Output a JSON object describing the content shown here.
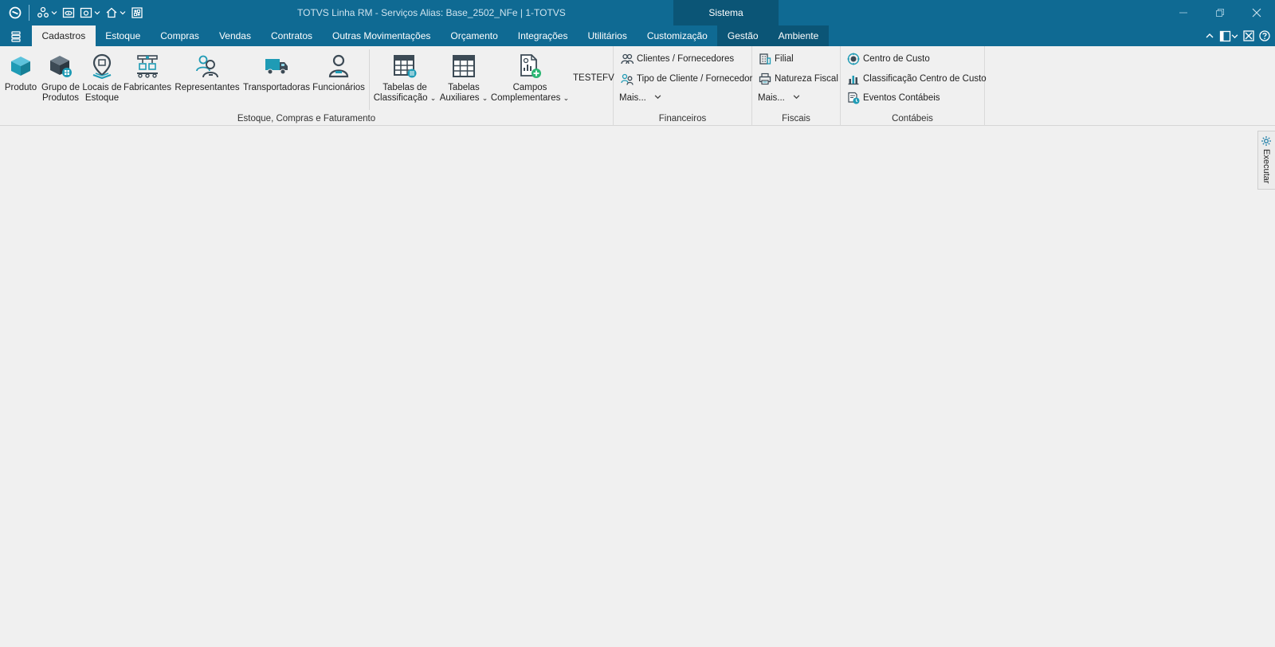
{
  "window": {
    "title": "TOTVS Linha RM - Serviços  Alias: Base_2502_NFe | 1-TOTVS",
    "context_tab_group": "Sistema"
  },
  "tabs": [
    {
      "label": "Cadastros",
      "active": true
    },
    {
      "label": "Estoque"
    },
    {
      "label": "Compras"
    },
    {
      "label": "Vendas"
    },
    {
      "label": "Contratos"
    },
    {
      "label": "Outras Movimentações"
    },
    {
      "label": "Orçamento"
    },
    {
      "label": "Integrações"
    },
    {
      "label": "Utilitários"
    },
    {
      "label": "Customização"
    },
    {
      "label": "Gestão",
      "context": true
    },
    {
      "label": "Ambiente",
      "context": true
    }
  ],
  "ribbon": {
    "estoque": {
      "label": "Estoque, Compras e Faturamento",
      "buttons": [
        {
          "line1": "Produto",
          "line2": ""
        },
        {
          "line1": "Grupo de",
          "line2": "Produtos"
        },
        {
          "line1": "Locais de",
          "line2": "Estoque"
        },
        {
          "line1": "Fabricantes",
          "line2": ""
        },
        {
          "line1": "Representantes",
          "line2": ""
        },
        {
          "line1": "Transportadoras",
          "line2": ""
        },
        {
          "line1": "Funcionários",
          "line2": ""
        },
        {
          "line1": "Tabelas de",
          "line2": "Classificação"
        },
        {
          "line1": "Tabelas",
          "line2": "Auxiliares"
        },
        {
          "line1": "Campos",
          "line2": "Complementares"
        }
      ],
      "testefv": "TESTEFV"
    },
    "financeiros": {
      "label": "Financeiros",
      "items": [
        "Clientes / Fornecedores",
        "Tipo de Cliente / Fornecedor",
        "Mais..."
      ]
    },
    "fiscais": {
      "label": "Fiscais",
      "items": [
        "Filial",
        "Natureza Fiscal",
        "Mais..."
      ]
    },
    "contabeis": {
      "label": "Contábeis",
      "items": [
        "Centro de Custo",
        "Classificação Centro de Custo",
        "Eventos Contábeis"
      ]
    }
  },
  "side_panel": {
    "label": "Executar"
  },
  "colors": {
    "titlebar": "#0f6a93",
    "context": "#0b5576",
    "teal": "#1f9bb5",
    "dark_icon": "#3c4a55",
    "green": "#2bb673"
  }
}
